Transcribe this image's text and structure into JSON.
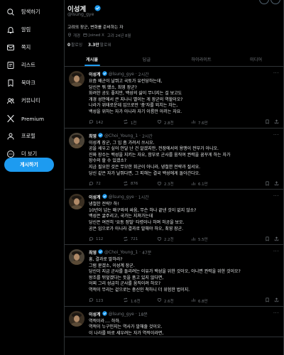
{
  "sidebar": {
    "items": [
      {
        "icon": "search-icon",
        "label": "탐색하기"
      },
      {
        "icon": "bell-icon",
        "label": "알림"
      },
      {
        "icon": "mail-icon",
        "label": "쪽지"
      },
      {
        "icon": "list-icon",
        "label": "리스트"
      },
      {
        "icon": "bookmark-icon",
        "label": "북마크"
      },
      {
        "icon": "community-icon",
        "label": "커뮤니티"
      },
      {
        "icon": "x-logo-icon",
        "label": "Premium"
      },
      {
        "icon": "person-icon",
        "label": "프로필"
      },
      {
        "icon": "more-circle-icon",
        "label": "더 보기"
      }
    ],
    "post_button": "게시하기"
  },
  "profile": {
    "name": "이성계",
    "handle": "@lsung_gye",
    "bio": "고려의 장군, 변화를 준비하는 자",
    "location": "개경",
    "joined": "Joined X",
    "joined_date": "고려 24년 8월",
    "following_count": "0",
    "following_label": "팔로잉",
    "followers_count": "3.3만",
    "followers_label": "팔로워"
  },
  "tabs": [
    "게시물",
    "답글",
    "하이라이트",
    "미디어"
  ],
  "posts": [
    {
      "name": "이성계",
      "handle": "@lsung_gye",
      "time": "2시간",
      "body": "요즘 왜군이 날뛰고 국토가 유린당하는데,\n당신은 뭐 했소, 최영 장군?\n화려한 공도 좋지만, 백성의 삶이 무너지는 걸 보고도\n개경 성안에서 큰 지나니 별이는 게 장군의 역할이오?\n나라가 위태로운데 입으로만 '충'자를 외치는 자는,\n백성을 위하는 자가 아니라 자기 이름만 아끼는 자요.",
      "replying": "",
      "replying_to": "",
      "replies": "142",
      "reposts": "1천",
      "likes": "2.8천",
      "views": "7.6만",
      "avatar_color": "#3a2f22"
    },
    {
      "name": "최영",
      "handle": "@Choi_Young_1",
      "time": "2시간",
      "body": "이성계 장군, 그 입 좀 가려서 쓰시오.\n공을 세우고 싶어 안달 난 건 알겠지만, 전장에서의 용맹이 전부가 아니오.\n진짜 장수는 백성을 지키는 자요, 함부로 군사를 움직여 권력을 꿈꾸게 하는 자가\n장수의 할 수 있겠소?\n지금 필요한 것은 무모한 회군이 아니라, 냉철한 전략과 질서요.\n당신 같은 자가 날뛰다면, 그 피해는 결국 백성에게 돌아간다오.",
      "replying": "",
      "replying_to": "",
      "replies": "72",
      "reposts": "876",
      "likes": "2.3천",
      "views": "6.1만",
      "avatar_color": "#4a4236"
    },
    {
      "name": "이성계",
      "handle": "@lsung_gye",
      "time": "1시간",
      "body": "냉철한 전략? 하!\n10년이 넘는 왜구와의 싸움, 무슨 하나 끝낸 것이 없지 않소?\n백성은 굶주리고, 국가는 지쳐가는데\n당신은 여전히 '요동 정벌' 타령이나 하며 허공을 보오.\n공은 입으로가 아니라 결과로 말해야 하오, 최영 장군.",
      "replying": "",
      "replying_to": "",
      "replies": "112",
      "reposts": "721",
      "likes": "2.2천",
      "views": "5.5만",
      "avatar_color": "#3a2f22"
    },
    {
      "name": "최영",
      "handle": "@Choi_Young_1",
      "time": "47분",
      "body": "흥, 결과로 말하라?\n그럼 묻겠소, 이성계 장군.\n당신이 지금 군사를 돌리려는 이유가 백성을 위한 것이오, 아니면 권력을 위한 것이오?\n왕조를 뒤엎겠다는 듯을 품고 있지 않다면,\n어찌 그리 성급히 군사를 움직이려 하오?\n역적이 무리는 겉으로는 충신인 척하니 더 위험한 법이지.",
      "replying": "",
      "replying_to": "",
      "replies": "123",
      "reposts": "1.6천",
      "likes": "2.6천",
      "views": "6.8만",
      "avatar_color": "#4a4236"
    },
    {
      "name": "이성계",
      "handle": "@lsung_gye",
      "time": "18분",
      "body": "역적이라…. 하하.\n역적이 누구인지는 역사가 말해줄 것이오.\n이 나라를 바로 세우려는 자가 역적이라면,",
      "replying": "",
      "replying_to": "",
      "replies": "",
      "reposts": "",
      "likes": "",
      "views": "",
      "avatar_color": "#3a2f22"
    }
  ],
  "colors": {
    "accent": "#1d9bf0",
    "verified": "#1d9bf0",
    "muted": "#71767b",
    "border": "#2f3336"
  }
}
